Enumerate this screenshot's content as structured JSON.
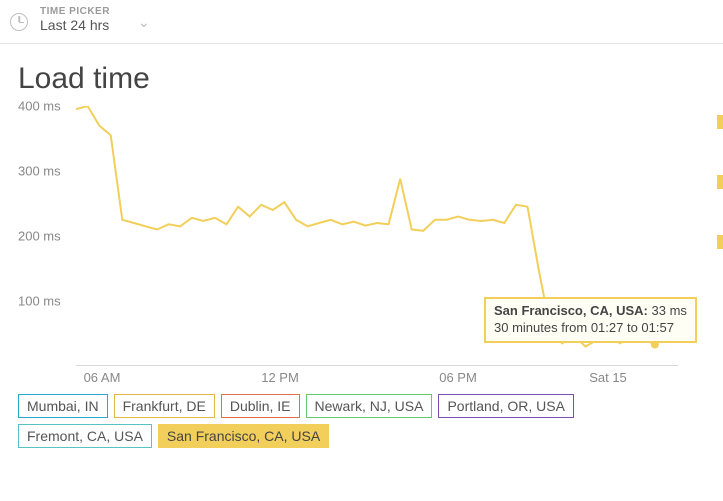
{
  "time_picker": {
    "label": "TIME PICKER",
    "value": "Last 24 hrs"
  },
  "chart_data": {
    "type": "line",
    "title": "Load time",
    "ylabel": "",
    "xlabel": "",
    "ylim": [
      0,
      400
    ],
    "y_ticks": [
      "400 ms",
      "300 ms",
      "200 ms",
      "100 ms"
    ],
    "x_ticks": [
      "06 AM",
      "12 PM",
      "06 PM",
      "Sat 15"
    ],
    "series_active": "San Francisco, CA, USA",
    "series": [
      {
        "name": "Mumbai, IN"
      },
      {
        "name": "Frankfurt, DE"
      },
      {
        "name": "Dublin, IE"
      },
      {
        "name": "Newark, NJ, USA"
      },
      {
        "name": "Portland, OR, USA"
      },
      {
        "name": "Fremont, CA, USA"
      },
      {
        "name": "San Francisco, CA, USA"
      }
    ],
    "values": [
      395,
      400,
      370,
      355,
      225,
      220,
      215,
      210,
      218,
      215,
      228,
      223,
      228,
      218,
      245,
      230,
      248,
      240,
      252,
      225,
      215,
      220,
      225,
      218,
      222,
      216,
      220,
      218,
      288,
      210,
      208,
      225,
      225,
      230,
      225,
      223,
      225,
      220,
      248,
      245,
      145,
      55,
      35,
      47,
      30,
      40,
      45,
      35,
      48,
      42,
      33,
      45,
      38
    ],
    "tooltip": {
      "location": "San Francisco, CA, USA:",
      "value": "33 ms",
      "detail": "30 minutes from 01:27 to 01:57"
    }
  },
  "legend": {
    "items": [
      {
        "label": "Mumbai, IN",
        "color": "#2aa7c9"
      },
      {
        "label": "Frankfurt, DE",
        "color": "#e0b84a"
      },
      {
        "label": "Dublin, IE",
        "color": "#e0704a"
      },
      {
        "label": "Newark, NJ, USA",
        "color": "#63c96a"
      },
      {
        "label": "Portland, OR, USA",
        "color": "#7a4fb3"
      },
      {
        "label": "Fremont, CA, USA",
        "color": "#59c2c2"
      },
      {
        "label": "San Francisco, CA, USA",
        "color": "#f2cf5b"
      }
    ],
    "active_index": 6
  }
}
